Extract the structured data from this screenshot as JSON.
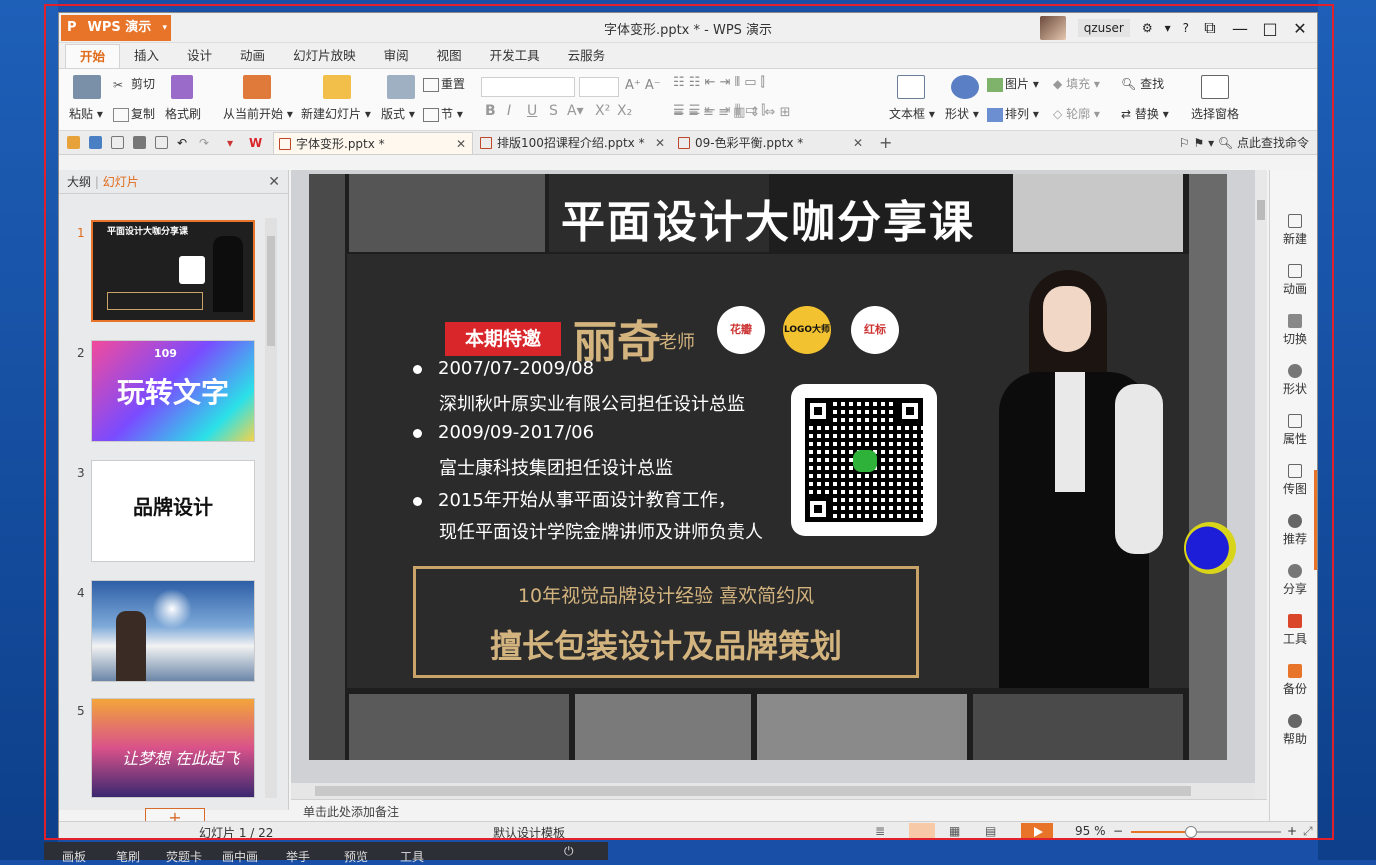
{
  "app": {
    "brand": "WPS 演示",
    "title": "字体变形.pptx * - WPS 演示",
    "user": "qzuser"
  },
  "menu_tabs": [
    "开始",
    "插入",
    "设计",
    "动画",
    "幻灯片放映",
    "审阅",
    "视图",
    "开发工具",
    "云服务"
  ],
  "ribbon": {
    "paste": "粘贴",
    "cut": "剪切",
    "copy": "复制",
    "format_painter": "格式刷",
    "from_current": "从当前开始",
    "new_slide": "新建幻灯片",
    "layout": "版式",
    "reset": "重置",
    "section": "节",
    "textbox": "文本框",
    "shape": "形状",
    "picture": "图片",
    "fill": "填充",
    "arrange": "排列",
    "outline": "轮廓",
    "find": "查找",
    "replace": "替换",
    "select_pane": "选择窗格"
  },
  "doc_tabs": [
    {
      "label": "字体变形.pptx *"
    },
    {
      "label": "排版100招课程介绍.pptx *"
    },
    {
      "label": "09-色彩平衡.pptx *"
    }
  ],
  "search_cmd": "点此查找命令",
  "left_panel": {
    "tab_outline": "大纲",
    "tab_slides": "幻灯片",
    "slides": [
      "1",
      "2",
      "3",
      "4",
      "5"
    ],
    "add_label": "+"
  },
  "slide": {
    "title": "平面设计大咖分享课",
    "badge": "本期特邀",
    "teacher_name": "丽奇",
    "teacher_suffix": "老师",
    "logos": [
      "花瓣",
      "LOGO大师",
      "红标"
    ],
    "bullets": [
      {
        "date": "2007/07-2009/08",
        "desc": "深圳秋叶原实业有限公司担任设计总监"
      },
      {
        "date": "2009/09-2017/06",
        "desc": "富士康科技集团担任设计总监"
      },
      {
        "date": "2015年开始从事平面设计教育工作，",
        "desc": "现任平面设计学院金牌讲师及讲师负责人"
      }
    ],
    "box_line1": "10年视觉品牌设计经验 喜欢简约风",
    "box_line2": "擅长包装设计及品牌策划"
  },
  "thumb2_text": "玩转文字",
  "thumb2_num": "109",
  "thumb3_text": "品牌设计",
  "thumb5_text": "让梦想 在此起飞",
  "notes_placeholder": "单击此处添加备注",
  "right_panel": [
    "新建",
    "动画",
    "切换",
    "形状",
    "属性",
    "传图",
    "推荐",
    "分享",
    "工具",
    "备份",
    "帮助"
  ],
  "status": {
    "slide_pos": "幻灯片 1 / 22",
    "template": "默认设计模板",
    "zoom": "95 %",
    "zoom_level": 0.4
  },
  "taskbar": [
    "画板",
    "笔刷",
    "荧题卡",
    "画中画",
    "举手",
    "预览",
    "工具"
  ],
  "colors": {
    "accent": "#e8742a",
    "slide_gold": "#d3b37e",
    "badge_red": "#d9262b"
  }
}
